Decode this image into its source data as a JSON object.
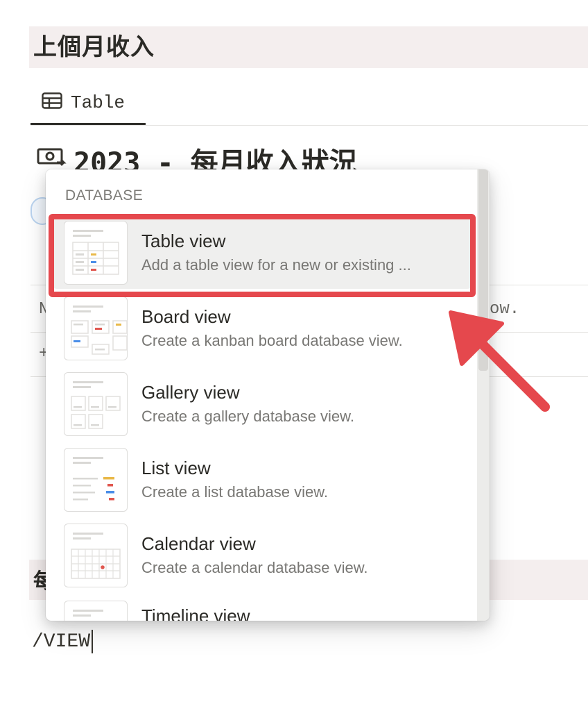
{
  "page": {
    "heading": "上個月收入",
    "tab_label": "Table",
    "db_title": "2023 - 每月收入狀況",
    "row_fragment_left": "N",
    "row_fragment_right": "ow.",
    "row_plus": "+",
    "bottom_heading_fragment": "每",
    "slash_input": "/VIEW"
  },
  "popup": {
    "section_label": "DATABASE",
    "items": [
      {
        "title": "Table view",
        "description": "Add a table view for a new or existing ...",
        "icon": "table-view-icon"
      },
      {
        "title": "Board view",
        "description": "Create a kanban board database view.",
        "icon": "board-view-icon"
      },
      {
        "title": "Gallery view",
        "description": "Create a gallery database view.",
        "icon": "gallery-view-icon"
      },
      {
        "title": "List view",
        "description": "Create a list database view.",
        "icon": "list-view-icon"
      },
      {
        "title": "Calendar view",
        "description": "Create a calendar database view.",
        "icon": "calendar-view-icon"
      },
      {
        "title": "Timeline view",
        "description": "",
        "icon": "timeline-view-icon"
      }
    ],
    "selected_index": 0
  },
  "colors": {
    "highlight": "#e5484d",
    "heading_background": "#f4eeee",
    "selected_row": "#efefee",
    "thumb_yellow": "#e9b949",
    "thumb_red": "#e0574f",
    "thumb_blue": "#4b8ee8"
  }
}
